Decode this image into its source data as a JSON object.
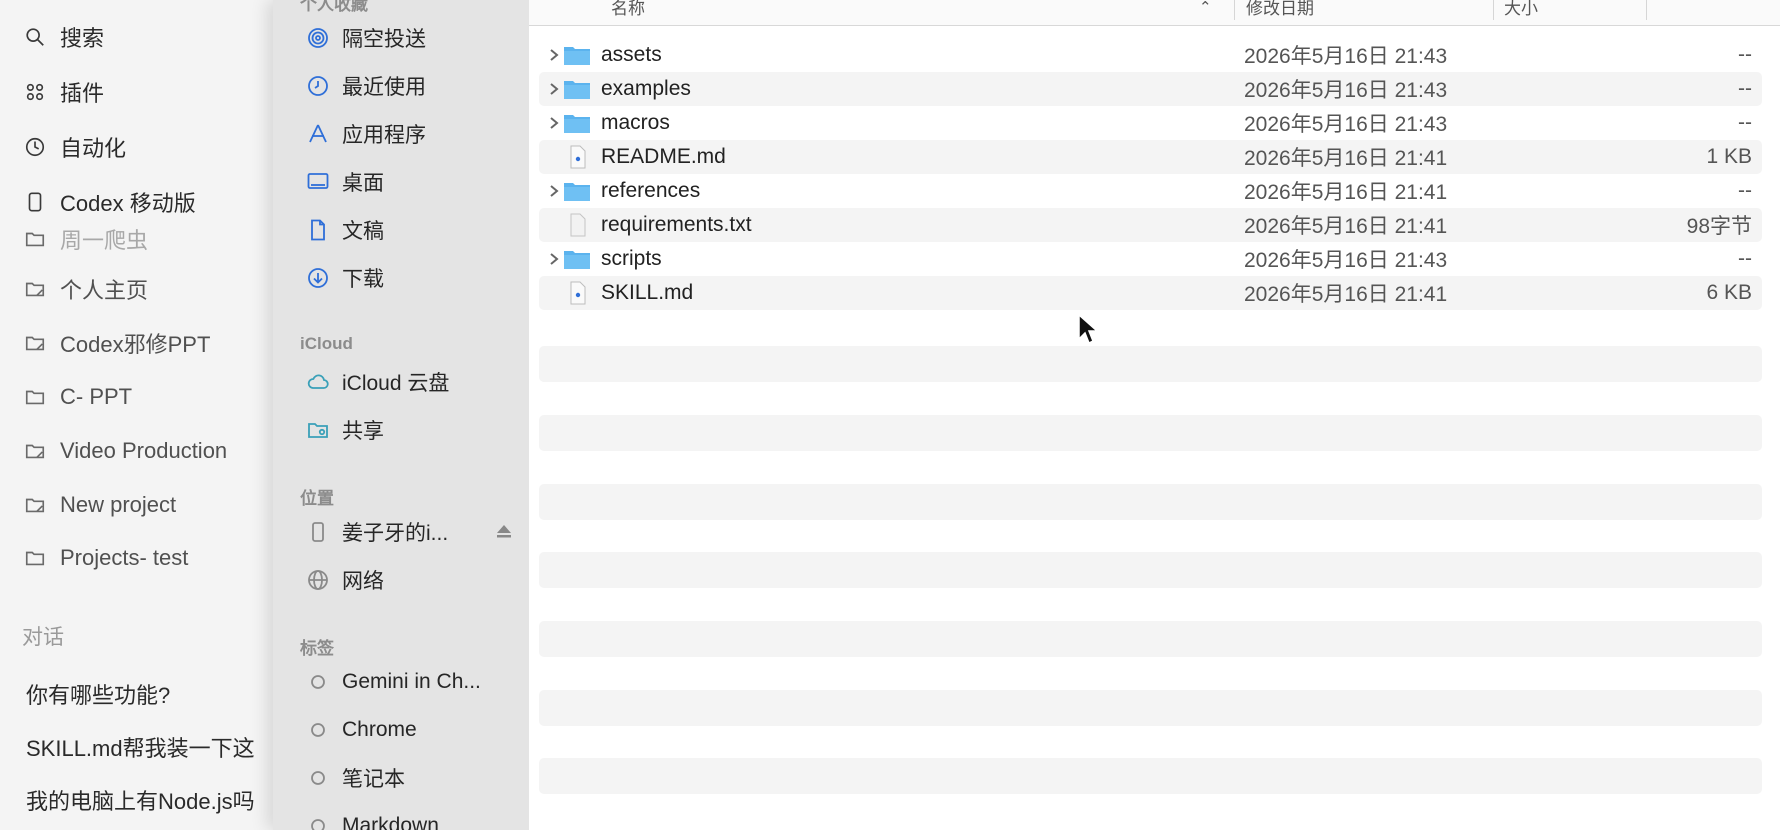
{
  "app_sidebar": {
    "nav": [
      {
        "label": "搜索",
        "icon": "search-icon"
      },
      {
        "label": "插件",
        "icon": "plugins-icon"
      },
      {
        "label": "自动化",
        "icon": "clock-icon"
      },
      {
        "label": "Codex 移动版",
        "icon": "phone-icon"
      }
    ],
    "projects": [
      {
        "label": "周一爬虫",
        "icon": "folder-icon"
      },
      {
        "label": "个人主页",
        "icon": "folder-icon"
      },
      {
        "label": "Codex邪修PPT",
        "icon": "folder-icon"
      },
      {
        "label": "C- PPT",
        "icon": "folder-icon"
      },
      {
        "label": "Video Production",
        "icon": "folder-icon"
      },
      {
        "label": "New project",
        "icon": "folder-icon"
      },
      {
        "label": "Projects- test",
        "icon": "folder-icon"
      }
    ],
    "conversations_title": "对话",
    "conversations": [
      "你有哪些功能?",
      "SKILL.md帮我装一下这",
      "我的电脑上有Node.js吗"
    ]
  },
  "finder_sidebar": {
    "favorites_title": "个人收藏",
    "favorites": [
      {
        "label": "隔空投送",
        "icon": "airdrop-icon"
      },
      {
        "label": "最近使用",
        "icon": "recents-icon"
      },
      {
        "label": "应用程序",
        "icon": "applications-icon"
      },
      {
        "label": "桌面",
        "icon": "desktop-icon"
      },
      {
        "label": "文稿",
        "icon": "document-icon"
      },
      {
        "label": "下载",
        "icon": "downloads-icon"
      }
    ],
    "icloud_title": "iCloud",
    "icloud": [
      {
        "label": "iCloud 云盘",
        "icon": "cloud-icon"
      },
      {
        "label": "共享",
        "icon": "shared-folder-icon"
      }
    ],
    "locations_title": "位置",
    "locations": [
      {
        "label": "姜子牙的i...",
        "icon": "iphone-icon"
      },
      {
        "label": "网络",
        "icon": "network-icon"
      }
    ],
    "tags_title": "标签",
    "tags": [
      {
        "label": "Gemini in Ch...",
        "icon": "tag-circle-icon"
      },
      {
        "label": "Chrome",
        "icon": "tag-circle-icon"
      },
      {
        "label": "笔记本",
        "icon": "tag-circle-icon"
      },
      {
        "label": "Markdown",
        "icon": "tag-circle-icon"
      }
    ]
  },
  "file_list": {
    "columns": {
      "name": "名称",
      "date": "修改日期",
      "size": "大小"
    },
    "rows": [
      {
        "name": "assets",
        "kind": "folder",
        "date": "2026年5月16日 21:43",
        "size": "--"
      },
      {
        "name": "examples",
        "kind": "folder",
        "date": "2026年5月16日 21:43",
        "size": "--"
      },
      {
        "name": "macros",
        "kind": "folder",
        "date": "2026年5月16日 21:43",
        "size": "--"
      },
      {
        "name": "README.md",
        "kind": "markdown",
        "date": "2026年5月16日 21:41",
        "size": "1 KB"
      },
      {
        "name": "references",
        "kind": "folder",
        "date": "2026年5月16日 21:41",
        "size": "--"
      },
      {
        "name": "requirements.txt",
        "kind": "text",
        "date": "2026年5月16日 21:41",
        "size": "98字节"
      },
      {
        "name": "scripts",
        "kind": "folder",
        "date": "2026年5月16日 21:43",
        "size": "--"
      },
      {
        "name": "SKILL.md",
        "kind": "markdown",
        "date": "2026年5月16日 21:41",
        "size": "6 KB"
      }
    ]
  },
  "colors": {
    "folder_blue": "#5bb3ee",
    "accent_blue": "#2f6fd8",
    "row_alt": "#f4f4f4"
  }
}
